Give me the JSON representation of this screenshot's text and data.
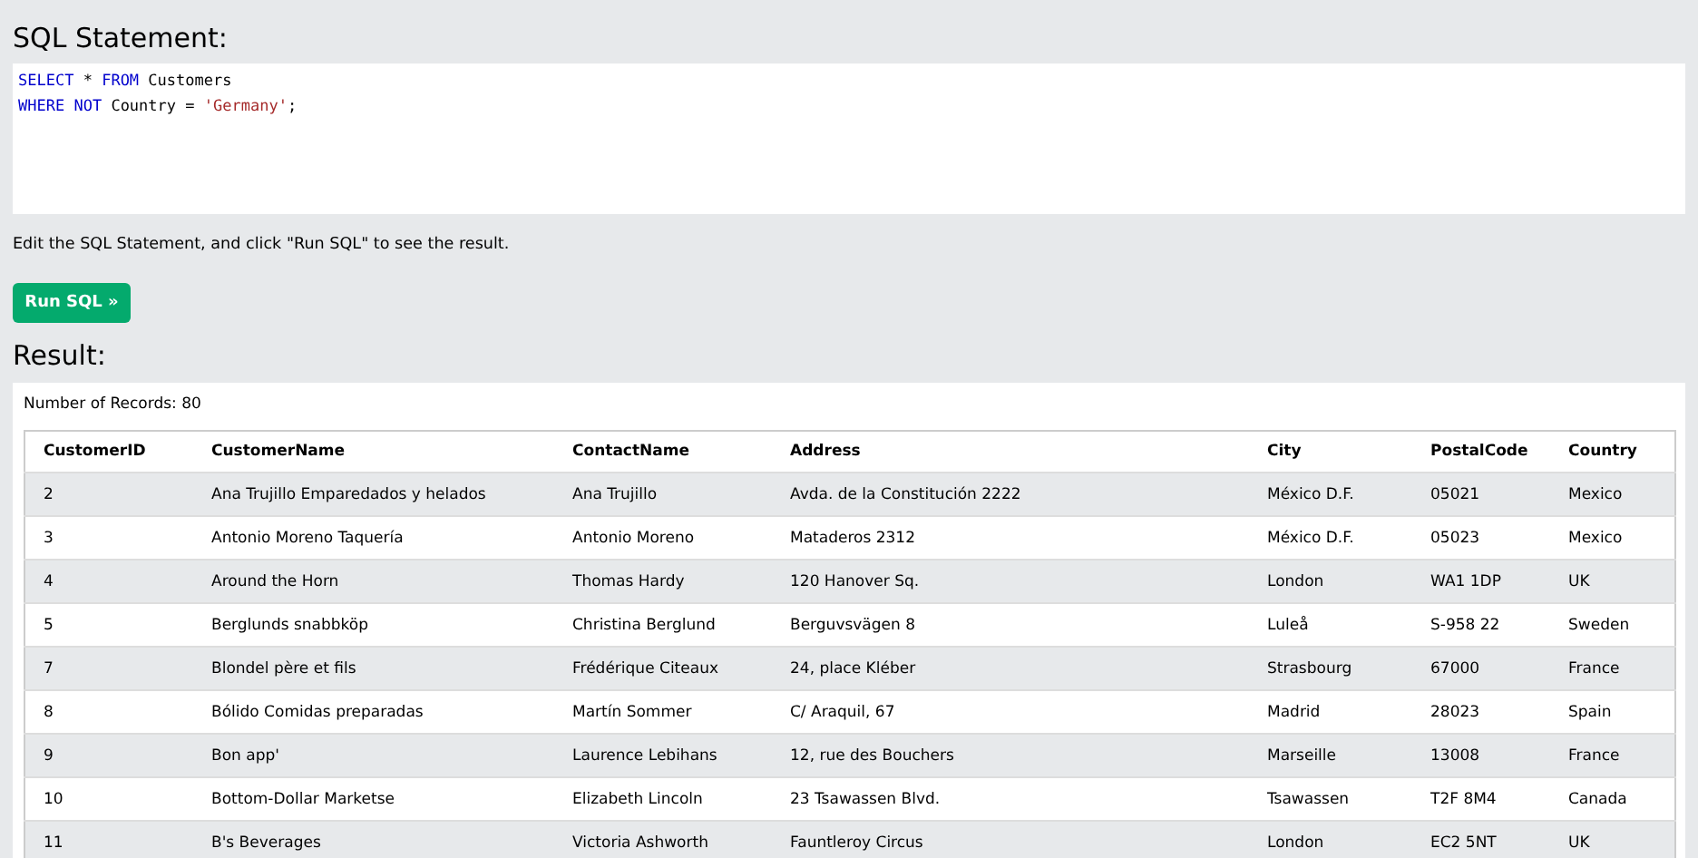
{
  "sql_heading": "SQL Statement:",
  "code_lines": [
    [
      {
        "kind": "keyword",
        "text": "SELECT"
      },
      {
        "kind": "plain",
        "text": " * "
      },
      {
        "kind": "keyword",
        "text": "FROM"
      },
      {
        "kind": "plain",
        "text": " Customers"
      }
    ],
    [
      {
        "kind": "keyword",
        "text": "WHERE"
      },
      {
        "kind": "keyword",
        "text": " NOT"
      },
      {
        "kind": "plain",
        "text": " Country = "
      },
      {
        "kind": "string",
        "text": "'Germany'"
      },
      {
        "kind": "plain",
        "text": ";"
      }
    ]
  ],
  "instructions": "Edit the SQL Statement, and click \"Run SQL\" to see the result.",
  "run_button": "Run SQL »",
  "result_heading": "Result:",
  "record_count": "Number of Records: 80",
  "table": {
    "columns": [
      "CustomerID",
      "CustomerName",
      "ContactName",
      "Address",
      "City",
      "PostalCode",
      "Country"
    ],
    "rows": [
      [
        "2",
        "Ana Trujillo Emparedados y helados",
        "Ana Trujillo",
        "Avda. de la Constitución 2222",
        "México D.F.",
        "05021",
        "Mexico"
      ],
      [
        "3",
        "Antonio Moreno Taquería",
        "Antonio Moreno",
        "Mataderos 2312",
        "México D.F.",
        "05023",
        "Mexico"
      ],
      [
        "4",
        "Around the Horn",
        "Thomas Hardy",
        "120 Hanover Sq.",
        "London",
        "WA1 1DP",
        "UK"
      ],
      [
        "5",
        "Berglunds snabbköp",
        "Christina Berglund",
        "Berguvsvägen 8",
        "Luleå",
        "S-958 22",
        "Sweden"
      ],
      [
        "7",
        "Blondel père et fils",
        "Frédérique Citeaux",
        "24, place Kléber",
        "Strasbourg",
        "67000",
        "France"
      ],
      [
        "8",
        "Bólido Comidas preparadas",
        "Martín Sommer",
        "C/ Araquil, 67",
        "Madrid",
        "28023",
        "Spain"
      ],
      [
        "9",
        "Bon app'",
        "Laurence Lebihans",
        "12, rue des Bouchers",
        "Marseille",
        "13008",
        "France"
      ],
      [
        "10",
        "Bottom-Dollar Marketse",
        "Elizabeth Lincoln",
        "23 Tsawassen Blvd.",
        "Tsawassen",
        "T2F 8M4",
        "Canada"
      ],
      [
        "11",
        "B's Beverages",
        "Victoria Ashworth",
        "Fauntleroy Circus",
        "London",
        "EC2 5NT",
        "UK"
      ]
    ]
  }
}
